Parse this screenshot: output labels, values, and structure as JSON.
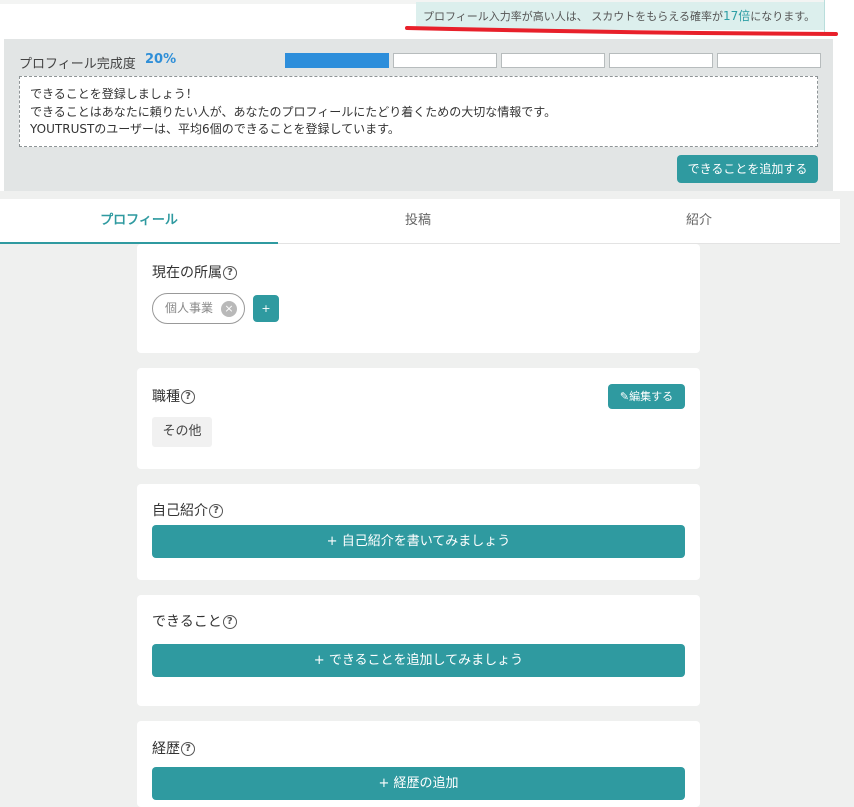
{
  "notice": {
    "text_before": "プロフィール入力率が高い人は、 スカウトをもらえる確率が",
    "highlight": "17倍",
    "text_after": "になります。"
  },
  "completion": {
    "label": "プロフィール完成度",
    "percent": "20%",
    "progress_fraction": 0.2,
    "segments_total": 5,
    "segments_filled": 1,
    "hint_lines": [
      "できることを登録しましょう！",
      "できることはあなたに頼りたい人が、あなたのプロフィールにたどり着くための大切な情報です。",
      "YOUTRUSTのユーザーは、平均6個のできることを登録しています。"
    ],
    "add_button": "できることを追加する"
  },
  "tabs": [
    {
      "label": "プロフィール",
      "active": true
    },
    {
      "label": "投稿",
      "active": false
    },
    {
      "label": "紹介",
      "active": false
    }
  ],
  "affiliation": {
    "title": "現在の所属",
    "help": "?",
    "chip": "個人事業",
    "chip_remove": "×",
    "add": "+"
  },
  "occupation": {
    "title": "職種",
    "help": "?",
    "edit_button": "編集する",
    "tag": "その他"
  },
  "intro": {
    "title": "自己紹介",
    "help": "?",
    "button": "+ 自己紹介を書いてみましょう"
  },
  "skills": {
    "title": "できること",
    "help": "?",
    "button": "+ できることを追加してみましょう"
  },
  "career": {
    "title": "経歴",
    "help": "?",
    "button": "+ 経歴の追加"
  },
  "colors": {
    "accent": "#2f9aa0",
    "progress_blue": "#2d8edb",
    "notice_bg": "#dcefed",
    "annotation_red": "#e8202a"
  }
}
